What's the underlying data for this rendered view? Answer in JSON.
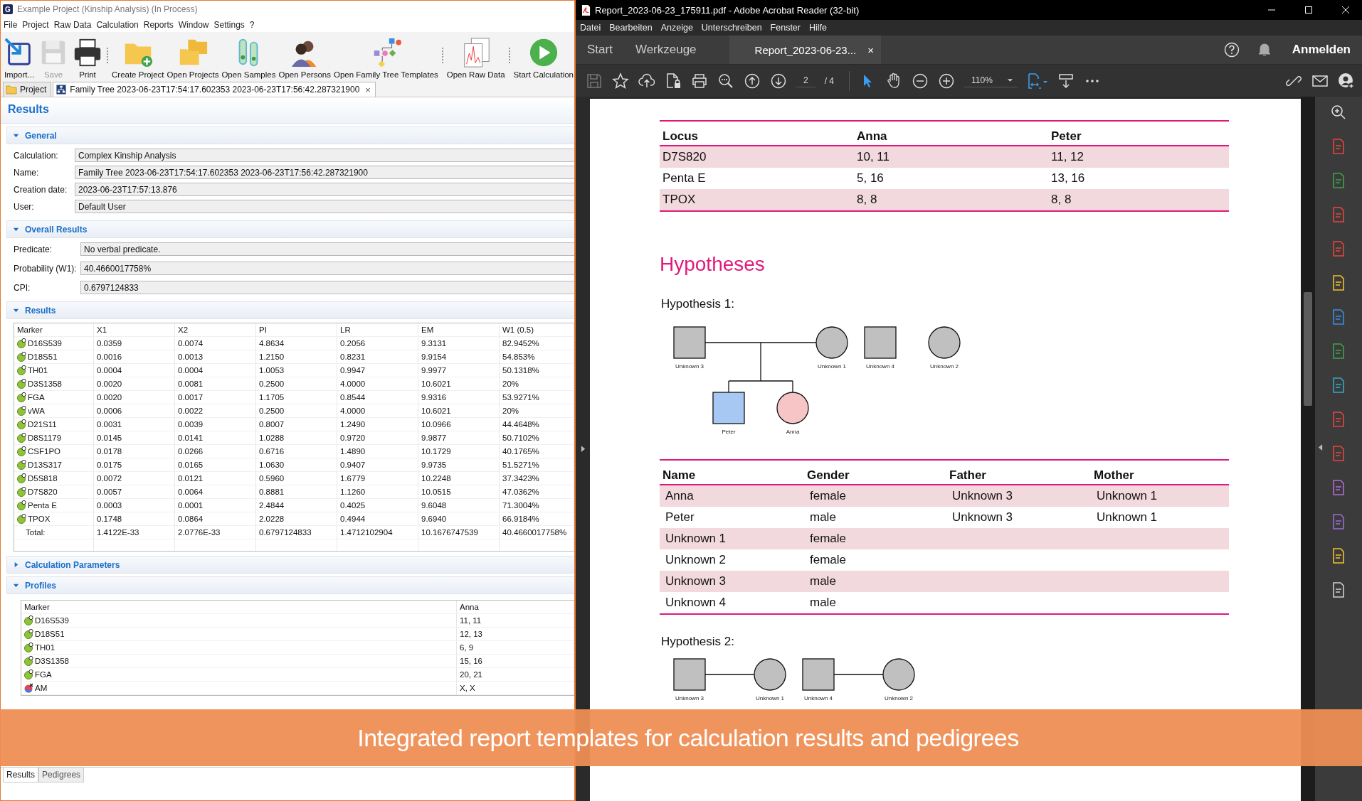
{
  "left_window": {
    "logo": "G",
    "title": "Example Project (Kinship Analysis) (In Process)",
    "menu": [
      "File",
      "Project",
      "Raw Data",
      "Calculation",
      "Reports",
      "Window",
      "Settings",
      "?"
    ],
    "toolbar": [
      [
        {
          "label": "Import...",
          "disabled": false
        },
        {
          "label": "Save",
          "disabled": true
        },
        {
          "label": "Print",
          "disabled": false
        }
      ],
      [
        {
          "label": "Create Project",
          "disabled": false
        },
        {
          "label": "Open Projects",
          "disabled": false
        },
        {
          "label": "Open Samples",
          "disabled": false
        },
        {
          "label": "Open Persons",
          "disabled": false
        },
        {
          "label": "Open Family Tree Templates",
          "disabled": false
        }
      ],
      [
        {
          "label": "Open Raw Data",
          "disabled": false
        }
      ],
      [
        {
          "label": "Start Calculation",
          "disabled": false
        }
      ]
    ],
    "tabs": [
      {
        "label": "Project",
        "selected": false
      },
      {
        "label": "Family Tree 2023-06-23T17:54:17.602353 2023-06-23T17:56:42.287321900",
        "selected": true,
        "close": "×"
      }
    ],
    "page_title": "Results",
    "sections": [
      {
        "kind": "fields",
        "title": "General",
        "expanded": true,
        "fields": [
          {
            "label": "Calculation:",
            "value": "Complex Kinship Analysis"
          },
          {
            "label": "Name:",
            "value": "Family Tree 2023-06-23T17:54:17.602353 2023-06-23T17:56:42.287321900"
          },
          {
            "label": "Creation date:",
            "value": "2023-06-23T17:57:13.876"
          },
          {
            "label": "User:",
            "value": "Default User"
          }
        ]
      },
      {
        "kind": "fields",
        "title": "Overall Results",
        "expanded": true,
        "fields": [
          {
            "label": "Predicate:",
            "value": "No verbal predicate."
          },
          {
            "label": "Probability (W1):",
            "value": "40.4660017758%"
          },
          {
            "label": "CPI:",
            "value": "0.6797124833"
          }
        ]
      },
      {
        "kind": "results",
        "title": "Results",
        "expanded": true,
        "columns": [
          "Marker",
          "X1",
          "X2",
          "PI",
          "LR",
          "EM",
          "W1 (0.5)"
        ],
        "rows": [
          [
            "D16S539",
            "0.0359",
            "0.0074",
            "4.8634",
            "0.2056",
            "9.3131",
            "82.9452%"
          ],
          [
            "D18S51",
            "0.0016",
            "0.0013",
            "1.2150",
            "0.8231",
            "9.9154",
            "54.853%"
          ],
          [
            "TH01",
            "0.0004",
            "0.0004",
            "1.0053",
            "0.9947",
            "9.9977",
            "50.1318%"
          ],
          [
            "D3S1358",
            "0.0020",
            "0.0081",
            "0.2500",
            "4.0000",
            "10.6021",
            "20%"
          ],
          [
            "FGA",
            "0.0020",
            "0.0017",
            "1.1705",
            "0.8544",
            "9.9316",
            "53.9271%"
          ],
          [
            "vWA",
            "0.0006",
            "0.0022",
            "0.2500",
            "4.0000",
            "10.6021",
            "20%"
          ],
          [
            "D21S11",
            "0.0031",
            "0.0039",
            "0.8007",
            "1.2490",
            "10.0966",
            "44.4648%"
          ],
          [
            "D8S1179",
            "0.0145",
            "0.0141",
            "1.0288",
            "0.9720",
            "9.9877",
            "50.7102%"
          ],
          [
            "CSF1PO",
            "0.0178",
            "0.0266",
            "0.6716",
            "1.4890",
            "10.1729",
            "40.1765%"
          ],
          [
            "D13S317",
            "0.0175",
            "0.0165",
            "1.0630",
            "0.9407",
            "9.9735",
            "51.5271%"
          ],
          [
            "D5S818",
            "0.0072",
            "0.0121",
            "0.5960",
            "1.6779",
            "10.2248",
            "37.3423%"
          ],
          [
            "D7S820",
            "0.0057",
            "0.0064",
            "0.8881",
            "1.1260",
            "10.0515",
            "47.0362%"
          ],
          [
            "Penta E",
            "0.0003",
            "0.0001",
            "2.4844",
            "0.4025",
            "9.6048",
            "71.3004%"
          ],
          [
            "TPOX",
            "0.1748",
            "0.0864",
            "2.0228",
            "0.4944",
            "9.6940",
            "66.9184%"
          ]
        ],
        "total": [
          "Total:",
          "1.4122E-33",
          "2.0776E-33",
          "0.6797124833",
          "1.4712102904",
          "10.1676747539",
          "40.4660017758%"
        ]
      },
      {
        "title": "Calculation Parameters",
        "expanded": false
      },
      {
        "kind": "profiles",
        "title": "Profiles",
        "expanded": true,
        "columns": [
          "Marker",
          "Anna"
        ],
        "rows": [
          {
            "kind": "str",
            "marker": "D16S539",
            "value": "11, 11"
          },
          {
            "kind": "str",
            "marker": "D18S51",
            "value": "12, 13"
          },
          {
            "kind": "str",
            "marker": "TH01",
            "value": "6, 9"
          },
          {
            "kind": "str",
            "marker": "D3S1358",
            "value": "15, 16"
          },
          {
            "kind": "str",
            "marker": "FGA",
            "value": "20, 21"
          },
          {
            "kind": "sex",
            "marker": "AM",
            "value": "X, X"
          }
        ]
      }
    ],
    "bottom_tabs": [
      {
        "label": "Results",
        "selected": true
      },
      {
        "label": "Pedigrees",
        "selected": false
      }
    ]
  },
  "acrobat": {
    "title": "Report_2023-06-23_175911.pdf - Adobe Acrobat Reader (32-bit)",
    "menu": [
      "Datei",
      "Bearbeiten",
      "Anzeige",
      "Unterschreiben",
      "Fenster",
      "Hilfe"
    ],
    "tabs": [
      {
        "label": "Start",
        "selected": false
      },
      {
        "label": "Werkzeuge",
        "selected": false
      },
      {
        "label": "Report_2023-06-23...",
        "selected": true,
        "close": "×"
      }
    ],
    "sign_in": "Anmelden",
    "page": "2",
    "pages": "/ 4",
    "zoom": "110%",
    "pointer_selected": true,
    "document": {
      "locus_table": {
        "columns": [
          "Locus",
          "Anna",
          "Peter"
        ],
        "rows": [
          [
            "D7S820",
            "10, 11",
            "11, 12"
          ],
          [
            "Penta E",
            "5, 16",
            "13, 16"
          ],
          [
            "TPOX",
            "8, 8",
            "8, 8"
          ]
        ]
      },
      "heading": "Hypotheses",
      "hypothesis_1": {
        "title": "Hypothesis 1:",
        "families": [
          {
            "father": {
              "name": "Unknown 3",
              "kind": "male",
              "color": "#c0c0c0"
            },
            "mother": {
              "name": "Unknown 1",
              "kind": "female",
              "color": "#c0c0c0"
            },
            "children": [
              {
                "name": "Peter",
                "kind": "male",
                "color": "#a6c8f2"
              },
              {
                "name": "Anna",
                "kind": "female",
                "color": "#f7c5c5"
              }
            ]
          }
        ],
        "singles": [
          {
            "name": "Unknown 4",
            "kind": "male",
            "color": "#c0c0c0"
          },
          {
            "name": "Unknown 2",
            "kind": "female",
            "color": "#c0c0c0"
          }
        ]
      },
      "persons_table": {
        "columns": [
          "Name",
          "Gender",
          "Father",
          "Mother"
        ],
        "rows": [
          [
            "Anna",
            "female",
            "Unknown 3",
            "Unknown 1"
          ],
          [
            "Peter",
            "male",
            "Unknown 3",
            "Unknown 1"
          ],
          [
            "Unknown 1",
            "female",
            "",
            ""
          ],
          [
            "Unknown 2",
            "female",
            "",
            ""
          ],
          [
            "Unknown 3",
            "male",
            "",
            ""
          ],
          [
            "Unknown 4",
            "male",
            "",
            ""
          ]
        ]
      },
      "hypothesis_2": {
        "title": "Hypothesis 2:",
        "families": [
          {
            "father": {
              "name": "Unknown 3",
              "kind": "male",
              "color": "#c0c0c0"
            },
            "mother": {
              "name": "Unknown 1",
              "kind": "female",
              "color": "#c0c0c0"
            }
          },
          {
            "father": {
              "name": "Unknown 4",
              "kind": "male",
              "color": "#c0c0c0"
            },
            "mother": {
              "name": "Unknown 2",
              "kind": "female",
              "color": "#c0c0c0"
            }
          }
        ]
      }
    }
  },
  "caption": "Integrated report templates for calculation results and pedigrees"
}
